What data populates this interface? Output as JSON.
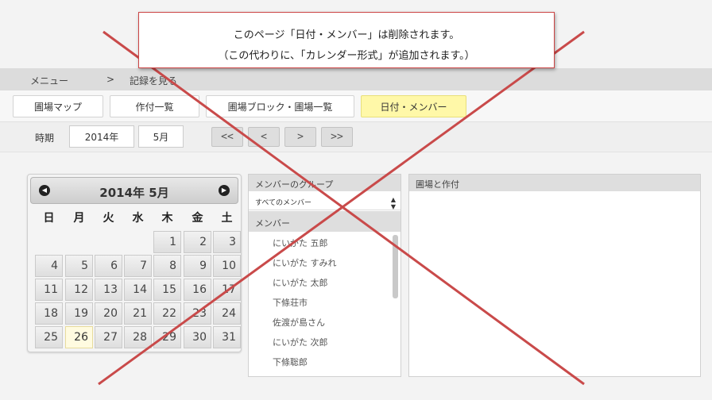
{
  "notice": {
    "line1": "このページ「日付・メンバー」は削除されます。",
    "line2": "（この代わりに、「カレンダー形式」が追加されます。）"
  },
  "breadcrumb": {
    "menu": "メニュー",
    "sep": ">",
    "current": "記録を見る"
  },
  "tabs": [
    "圃場マップ",
    "作付一覧",
    "圃場ブロック・圃場一覧",
    "日付・メンバー"
  ],
  "period": {
    "label": "時期",
    "year": "2014年",
    "month": "5月",
    "nav": [
      "<<",
      "<",
      ">",
      ">>"
    ]
  },
  "calendar": {
    "title": "2014年 5月",
    "weekdays": [
      "日",
      "月",
      "火",
      "水",
      "木",
      "金",
      "土"
    ],
    "weeks": [
      [
        "",
        "",
        "",
        "",
        "1",
        "2",
        "3"
      ],
      [
        "4",
        "5",
        "6",
        "7",
        "8",
        "9",
        "10"
      ],
      [
        "11",
        "12",
        "13",
        "14",
        "15",
        "16",
        "17"
      ],
      [
        "18",
        "19",
        "20",
        "21",
        "22",
        "23",
        "24"
      ],
      [
        "25",
        "26",
        "27",
        "28",
        "29",
        "30",
        "31"
      ]
    ],
    "today": "26"
  },
  "member_panel": {
    "group_header": "メンバーのグループ",
    "group_selected": "すべてのメンバー",
    "members_header": "メンバー",
    "members": [
      "にいがた 五郎",
      "にいがた すみれ",
      "にいがた 太郎",
      "下條荘市",
      "佐渡が島さん",
      "にいがた 次郎",
      "下條聡郎"
    ]
  },
  "right_panel": {
    "header": "圃場と作付"
  },
  "colors": {
    "active_tab": "#fff8a8",
    "cross_line": "#c94a4a"
  }
}
